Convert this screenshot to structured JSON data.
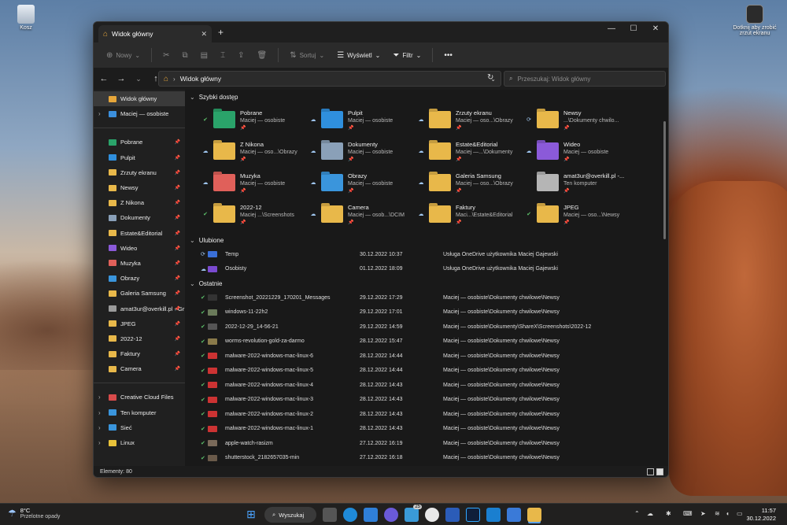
{
  "desktop": {
    "recycle_bin_label": "Kosz",
    "screenshot_widget_label": "Dotknij aby zrobić zrzut ekranu"
  },
  "window": {
    "tab_title": "Widok główny",
    "controls": {
      "minimize": "—",
      "maximize": "☐",
      "close": "✕"
    }
  },
  "toolbar": {
    "new_label": "Nowy",
    "sort_label": "Sortuj",
    "view_label": "Wyświetl",
    "filter_label": "Filtr"
  },
  "address": {
    "path": "Widok główny",
    "search_placeholder": "Przeszukaj: Widok główny"
  },
  "sidebar": {
    "top": [
      {
        "label": "Widok główny",
        "icon": "home-icon",
        "color": "#e6a63a"
      },
      {
        "label": "Maciej — osobiste",
        "icon": "onedrive-icon",
        "color": "#3b8fdc"
      }
    ],
    "pinned": [
      {
        "label": "Pobrane",
        "color": "#2aa36a"
      },
      {
        "label": "Pulpit",
        "color": "#2f8fdd"
      },
      {
        "label": "Zrzuty ekranu",
        "color": "#e8b84a"
      },
      {
        "label": "Newsy",
        "color": "#e8b84a"
      },
      {
        "label": "Z Nikona",
        "color": "#e8b84a"
      },
      {
        "label": "Dokumenty",
        "color": "#8aa0b8"
      },
      {
        "label": "Estate&Editorial",
        "color": "#e8b84a"
      },
      {
        "label": "Wideo",
        "color": "#8b5ad9"
      },
      {
        "label": "Muzyka",
        "color": "#e0605a"
      },
      {
        "label": "Obrazy",
        "color": "#3a95dc"
      },
      {
        "label": "Galeria Samsung",
        "color": "#e8b84a"
      },
      {
        "label": "amat3ur@overkill.pl - Gr",
        "color": "#9a9a9a"
      },
      {
        "label": "JPEG",
        "color": "#e8b84a"
      },
      {
        "label": "2022-12",
        "color": "#e8b84a"
      },
      {
        "label": "Faktury",
        "color": "#e8b84a"
      },
      {
        "label": "Camera",
        "color": "#e8b84a"
      }
    ],
    "bottom": [
      {
        "label": "Creative Cloud Files",
        "color": "#d84b4b"
      },
      {
        "label": "Ten komputer",
        "color": "#3a95dc"
      },
      {
        "label": "Sieć",
        "color": "#3a95dc"
      },
      {
        "label": "Linux",
        "color": "#e8c23a"
      }
    ]
  },
  "quick_access": {
    "title": "Szybki dostęp",
    "items": [
      {
        "name": "Pobrane",
        "path": "Maciej — osobiste",
        "status": "✔",
        "color": "#2aa36a"
      },
      {
        "name": "Pulpit",
        "path": "Maciej — osobiste",
        "status": "☁",
        "color": "#2f8fdd"
      },
      {
        "name": "Zrzuty ekranu",
        "path": "Maciej — oso...\\Obrazy",
        "status": "☁",
        "color": "#e8b84a"
      },
      {
        "name": "Newsy",
        "path": "...\\Dokumenty chwilo...",
        "status": "⟳",
        "color": "#e8b84a"
      },
      {
        "name": "Z Nikona",
        "path": "Maciej — oso...\\Obrazy",
        "status": "☁",
        "color": "#e8b84a"
      },
      {
        "name": "Dokumenty",
        "path": "Maciej — osobiste",
        "status": "☁",
        "color": "#8aa0b8"
      },
      {
        "name": "Estate&Editorial",
        "path": "Maciej —...\\Dokumenty",
        "status": "☁",
        "color": "#e8b84a"
      },
      {
        "name": "Wideo",
        "path": "Maciej — osobiste",
        "status": "☁",
        "color": "#8b5ad9"
      },
      {
        "name": "Muzyka",
        "path": "Maciej — osobiste",
        "status": "☁",
        "color": "#e0605a"
      },
      {
        "name": "Obrazy",
        "path": "Maciej — osobiste",
        "status": "☁",
        "color": "#3a95dc"
      },
      {
        "name": "Galeria Samsung",
        "path": "Maciej — oso...\\Obrazy",
        "status": "☁",
        "color": "#e8b84a"
      },
      {
        "name": "amat3ur@overkill.pl -...",
        "path": "Ten komputer",
        "status": "",
        "color": "#b5b5b5"
      },
      {
        "name": "2022-12",
        "path": "Maciej ...\\Screenshots",
        "status": "✔",
        "color": "#e8b84a"
      },
      {
        "name": "Camera",
        "path": "Maciej — osob...\\DCIM",
        "status": "☁",
        "color": "#e8b84a"
      },
      {
        "name": "Faktury",
        "path": "Maci...\\Estate&Editorial",
        "status": "☁",
        "color": "#e8b84a"
      },
      {
        "name": "JPEG",
        "path": "Maciej — oso...\\Newsy",
        "status": "✔",
        "color": "#e8b84a"
      }
    ]
  },
  "favorites": {
    "title": "Ulubione",
    "items": [
      {
        "name": "Temp",
        "date": "30.12.2022 10:37",
        "location": "Usługa OneDrive użytkownika Maciej Gajewski",
        "status": "⟳",
        "color": "#3a6fd8"
      },
      {
        "name": "Osobisty",
        "date": "01.12.2022 18:09",
        "location": "Usługa OneDrive użytkownika Maciej Gajewski",
        "status": "☁",
        "color": "#7a4ad0"
      }
    ]
  },
  "recent": {
    "title": "Ostatnie",
    "items": [
      {
        "name": "Screenshot_20221229_170201_Messages",
        "date": "29.12.2022 17:29",
        "location": "Maciej — osobiste\\Dokumenty chwilowe\\Newsy",
        "color": "#333"
      },
      {
        "name": "windows-11-22h2",
        "date": "29.12.2022 17:01",
        "location": "Maciej — osobiste\\Dokumenty chwilowe\\Newsy",
        "color": "#6a7a5a"
      },
      {
        "name": "2022-12-29_14-56-21",
        "date": "29.12.2022 14:59",
        "location": "Maciej — osobiste\\Dokumenty\\ShareX\\Screenshots\\2022-12",
        "color": "#555"
      },
      {
        "name": "worms-revolution-gold-za-darmo",
        "date": "28.12.2022 15:47",
        "location": "Maciej — osobiste\\Dokumenty chwilowe\\Newsy",
        "color": "#8a7a4a"
      },
      {
        "name": "malware-2022-windows-mac-linux-6",
        "date": "28.12.2022 14:44",
        "location": "Maciej — osobiste\\Dokumenty chwilowe\\Newsy",
        "color": "#c33"
      },
      {
        "name": "malware-2022-windows-mac-linux-5",
        "date": "28.12.2022 14:44",
        "location": "Maciej — osobiste\\Dokumenty chwilowe\\Newsy",
        "color": "#c33"
      },
      {
        "name": "malware-2022-windows-mac-linux-4",
        "date": "28.12.2022 14:43",
        "location": "Maciej — osobiste\\Dokumenty chwilowe\\Newsy",
        "color": "#c33"
      },
      {
        "name": "malware-2022-windows-mac-linux-3",
        "date": "28.12.2022 14:43",
        "location": "Maciej — osobiste\\Dokumenty chwilowe\\Newsy",
        "color": "#c33"
      },
      {
        "name": "malware-2022-windows-mac-linux-2",
        "date": "28.12.2022 14:43",
        "location": "Maciej — osobiste\\Dokumenty chwilowe\\Newsy",
        "color": "#c33"
      },
      {
        "name": "malware-2022-windows-mac-linux-1",
        "date": "28.12.2022 14:43",
        "location": "Maciej — osobiste\\Dokumenty chwilowe\\Newsy",
        "color": "#c33"
      },
      {
        "name": "apple-watch-rasizm",
        "date": "27.12.2022 16:19",
        "location": "Maciej — osobiste\\Dokumenty chwilowe\\Newsy",
        "color": "#7a6a5a"
      },
      {
        "name": "shutterstock_2182657035-min",
        "date": "27.12.2022 16:18",
        "location": "Maciej — osobiste\\Dokumenty chwilowe\\Newsy",
        "color": "#6a5a4a"
      }
    ]
  },
  "status": {
    "items_count": "Elementy: 80"
  },
  "taskbar": {
    "weather_temp": "8°C",
    "weather_desc": "Przelotne opady",
    "search_label": "Wyszukaj",
    "badge_count": "25",
    "time": "11:57",
    "date": "30.12.2022"
  }
}
